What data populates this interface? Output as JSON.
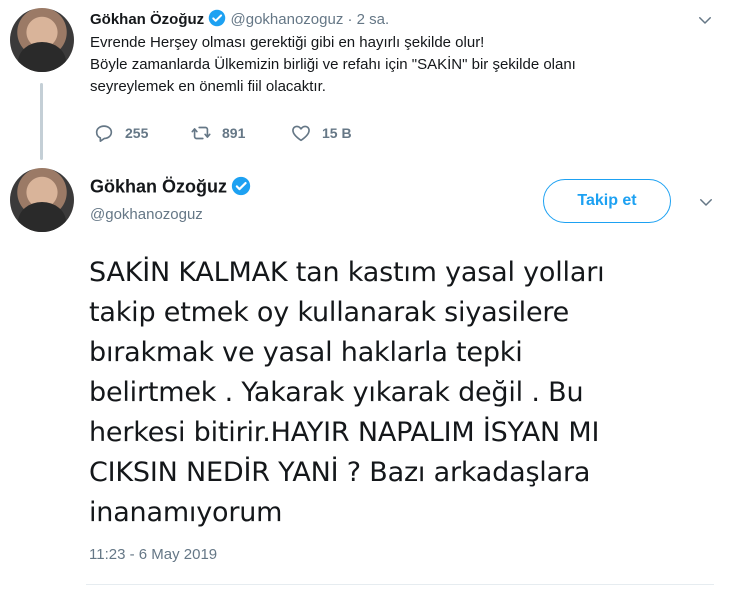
{
  "tweet1": {
    "display_name": "Gökhan Özoğuz",
    "handle": "@gokhanozoguz",
    "separator": "·",
    "time": "2 sa.",
    "lines": [
      "Evrende Herşey olması gerektiği gibi en hayırlı şekilde  olur!",
      "Böyle zamanlarda Ülkemizin birliği ve refahı için \"SAKİN\" bir şekilde olanı",
      "seyreylemek en önemli fiil olacaktır."
    ],
    "replies": "255",
    "retweets": "891",
    "likes": "15 B"
  },
  "tweet2": {
    "display_name": "Gökhan Özoğuz",
    "handle": "@gokhanozoguz",
    "follow_label": "Takip et",
    "lines": [
      "SAKİN KALMAK tan kastım yasal yolları",
      "takip etmek oy kullanarak siyasilere",
      "bırakmak ve yasal haklarla  tepki",
      "belirtmek . Yakarak yıkarak değil . Bu",
      "herkesi bitirir.HAYIR NAPALIM İSYAN MI",
      "CIKSIN NEDİR YANİ ? Bazı arkadaşlara",
      "inanamıyorum"
    ],
    "timestamp": "11:23 - 6 May 2019"
  },
  "colors": {
    "accent": "#1da1f2",
    "muted": "#657786",
    "text": "#14171a"
  }
}
